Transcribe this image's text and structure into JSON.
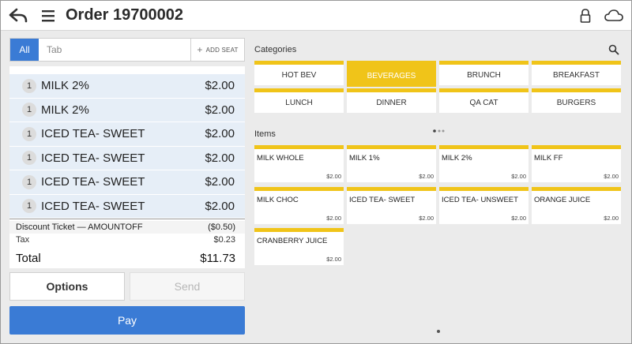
{
  "header": {
    "title": "Order 19700002"
  },
  "tabbar": {
    "all_label": "All",
    "tab_placeholder": "Tab",
    "add_seat_label": "ADD SEAT"
  },
  "ticket": {
    "items": [
      {
        "qty": "1",
        "name": "MILK 2%",
        "price": "$2.00"
      },
      {
        "qty": "1",
        "name": "MILK 2%",
        "price": "$2.00"
      },
      {
        "qty": "1",
        "name": "ICED TEA- SWEET",
        "price": "$2.00"
      },
      {
        "qty": "1",
        "name": "ICED TEA- SWEET",
        "price": "$2.00"
      },
      {
        "qty": "1",
        "name": "ICED TEA- SWEET",
        "price": "$2.00"
      },
      {
        "qty": "1",
        "name": "ICED TEA- SWEET",
        "price": "$2.00"
      }
    ],
    "discount": {
      "label": "Discount Ticket — AMOUNTOFF",
      "amount": "($0.50)"
    },
    "tax": {
      "label": "Tax",
      "amount": "$0.23"
    },
    "total": {
      "label": "Total",
      "amount": "$11.73"
    }
  },
  "actions": {
    "options_label": "Options",
    "send_label": "Send",
    "pay_label": "Pay"
  },
  "categories": {
    "label": "Categories",
    "items": [
      {
        "label": "HOT BEV",
        "active": false
      },
      {
        "label": "BEVERAGES",
        "active": true
      },
      {
        "label": "BRUNCH",
        "active": false
      },
      {
        "label": "BREAKFAST",
        "active": false
      },
      {
        "label": "LUNCH",
        "active": false
      },
      {
        "label": "DINNER",
        "active": false
      },
      {
        "label": "QA CAT",
        "active": false
      },
      {
        "label": "BURGERS",
        "active": false
      }
    ]
  },
  "menu_items": {
    "label": "Items",
    "items": [
      {
        "name": "MILK WHOLE",
        "price": "$2.00"
      },
      {
        "name": "MILK 1%",
        "price": "$2.00"
      },
      {
        "name": "MILK 2%",
        "price": "$2.00"
      },
      {
        "name": "MILK FF",
        "price": "$2.00"
      },
      {
        "name": "MILK CHOC",
        "price": "$2.00"
      },
      {
        "name": "ICED TEA- SWEET",
        "price": "$2.00"
      },
      {
        "name": "ICED TEA- UNSWEET",
        "price": "$2.00"
      },
      {
        "name": "ORANGE JUICE",
        "price": "$2.00"
      },
      {
        "name": "CRANBERRY JUICE",
        "price": "$2.00"
      }
    ]
  },
  "colors": {
    "accent_blue": "#3a7bd5",
    "category_yellow": "#f0c419"
  },
  "icons": [
    "back-arrow-icon",
    "hamburger-menu-icon",
    "lock-icon",
    "cloud-icon",
    "search-icon",
    "plus-icon"
  ]
}
